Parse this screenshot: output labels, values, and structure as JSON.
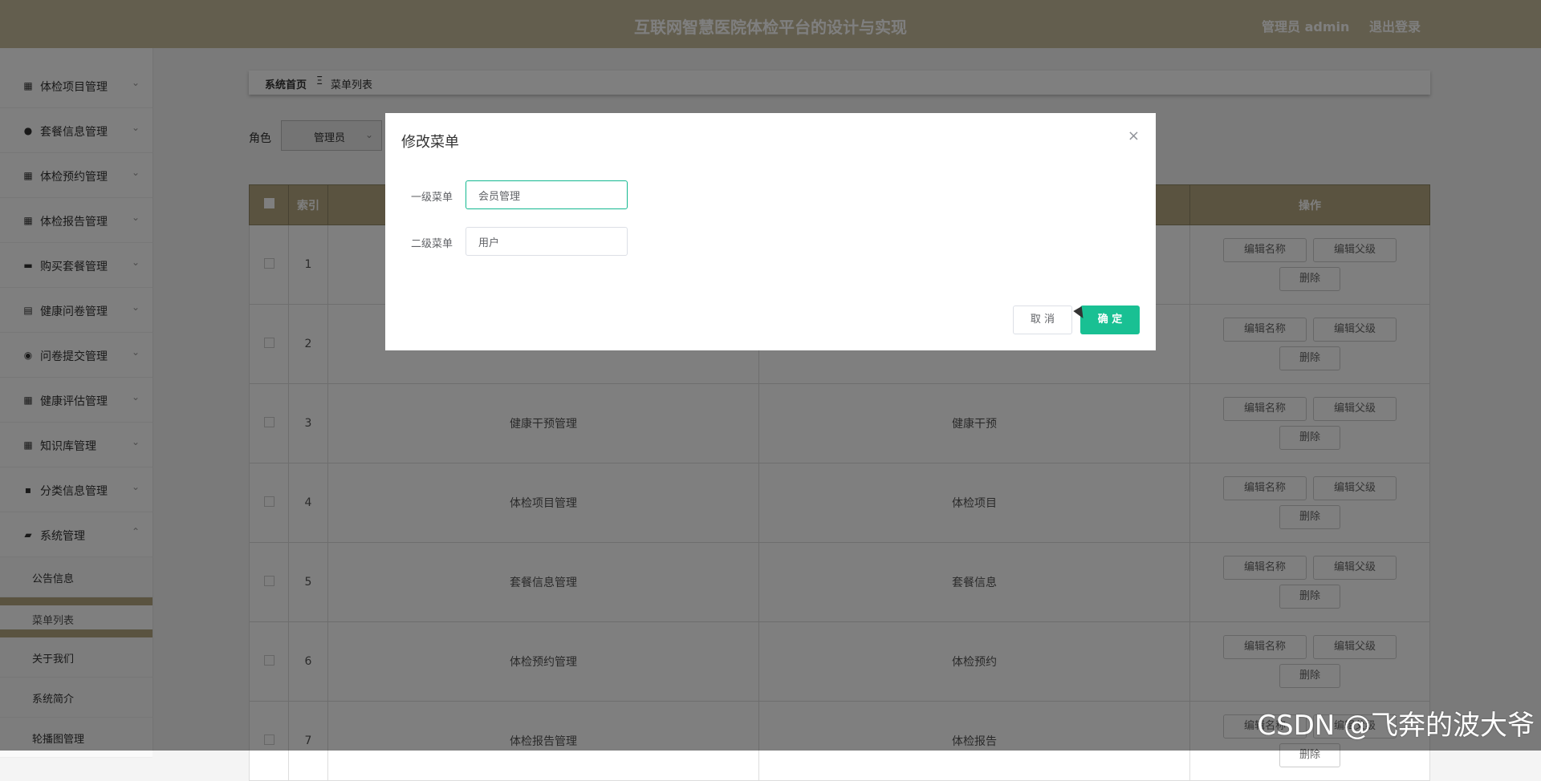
{
  "header": {
    "title": "互联网智慧医院体检平台的设计与实现",
    "admin": "管理员 admin",
    "logout": "退出登录"
  },
  "sidebar": {
    "items": [
      {
        "label": "体检项目管理",
        "icon": "grid-icon"
      },
      {
        "label": "套餐信息管理",
        "icon": "user-icon"
      },
      {
        "label": "体检预约管理",
        "icon": "grid-icon"
      },
      {
        "label": "体检报告管理",
        "icon": "grid-icon"
      },
      {
        "label": "购买套餐管理",
        "icon": "card-icon"
      },
      {
        "label": "健康问卷管理",
        "icon": "clipboard-icon"
      },
      {
        "label": "问卷提交管理",
        "icon": "pin-icon"
      },
      {
        "label": "健康评估管理",
        "icon": "grid-icon"
      },
      {
        "label": "知识库管理",
        "icon": "grid-icon"
      },
      {
        "label": "分类信息管理",
        "icon": "chat-icon"
      },
      {
        "label": "系统管理",
        "icon": "folder-icon"
      }
    ],
    "sub_items": [
      {
        "label": "公告信息"
      },
      {
        "label": "菜单列表"
      },
      {
        "label": "关于我们"
      },
      {
        "label": "系统简介"
      },
      {
        "label": "轮播图管理"
      }
    ]
  },
  "breadcrumb": {
    "home": "系统首页",
    "separator": "Ξ",
    "current": "菜单列表"
  },
  "filter": {
    "role_label": "角色",
    "role_value": "管理员"
  },
  "table": {
    "headers": {
      "index": "索引",
      "ops": "操作"
    },
    "op_labels": {
      "edit_name": "编辑名称",
      "edit_parent": "编辑父级",
      "delete": "删除"
    },
    "rows": [
      {
        "index": "1",
        "menu": "",
        "sub": ""
      },
      {
        "index": "2",
        "menu": "",
        "sub": ""
      },
      {
        "index": "3",
        "menu": "健康干预管理",
        "sub": "健康干预"
      },
      {
        "index": "4",
        "menu": "体检项目管理",
        "sub": "体检项目"
      },
      {
        "index": "5",
        "menu": "套餐信息管理",
        "sub": "套餐信息"
      },
      {
        "index": "6",
        "menu": "体检预约管理",
        "sub": "体检预约"
      },
      {
        "index": "7",
        "menu": "体检报告管理",
        "sub": "体检报告"
      }
    ]
  },
  "dialog": {
    "title": "修改菜单",
    "close": "×",
    "field1_label": "一级菜单",
    "field1_value": "会员管理",
    "field2_label": "二级菜单",
    "field2_value": "用户",
    "cancel": "取 消",
    "confirm": "确 定"
  },
  "watermark": "CSDN @飞奔的波大爷",
  "colors": {
    "header": "#c7bc9c",
    "table_header": "#b4a780",
    "primary": "#19c093"
  }
}
